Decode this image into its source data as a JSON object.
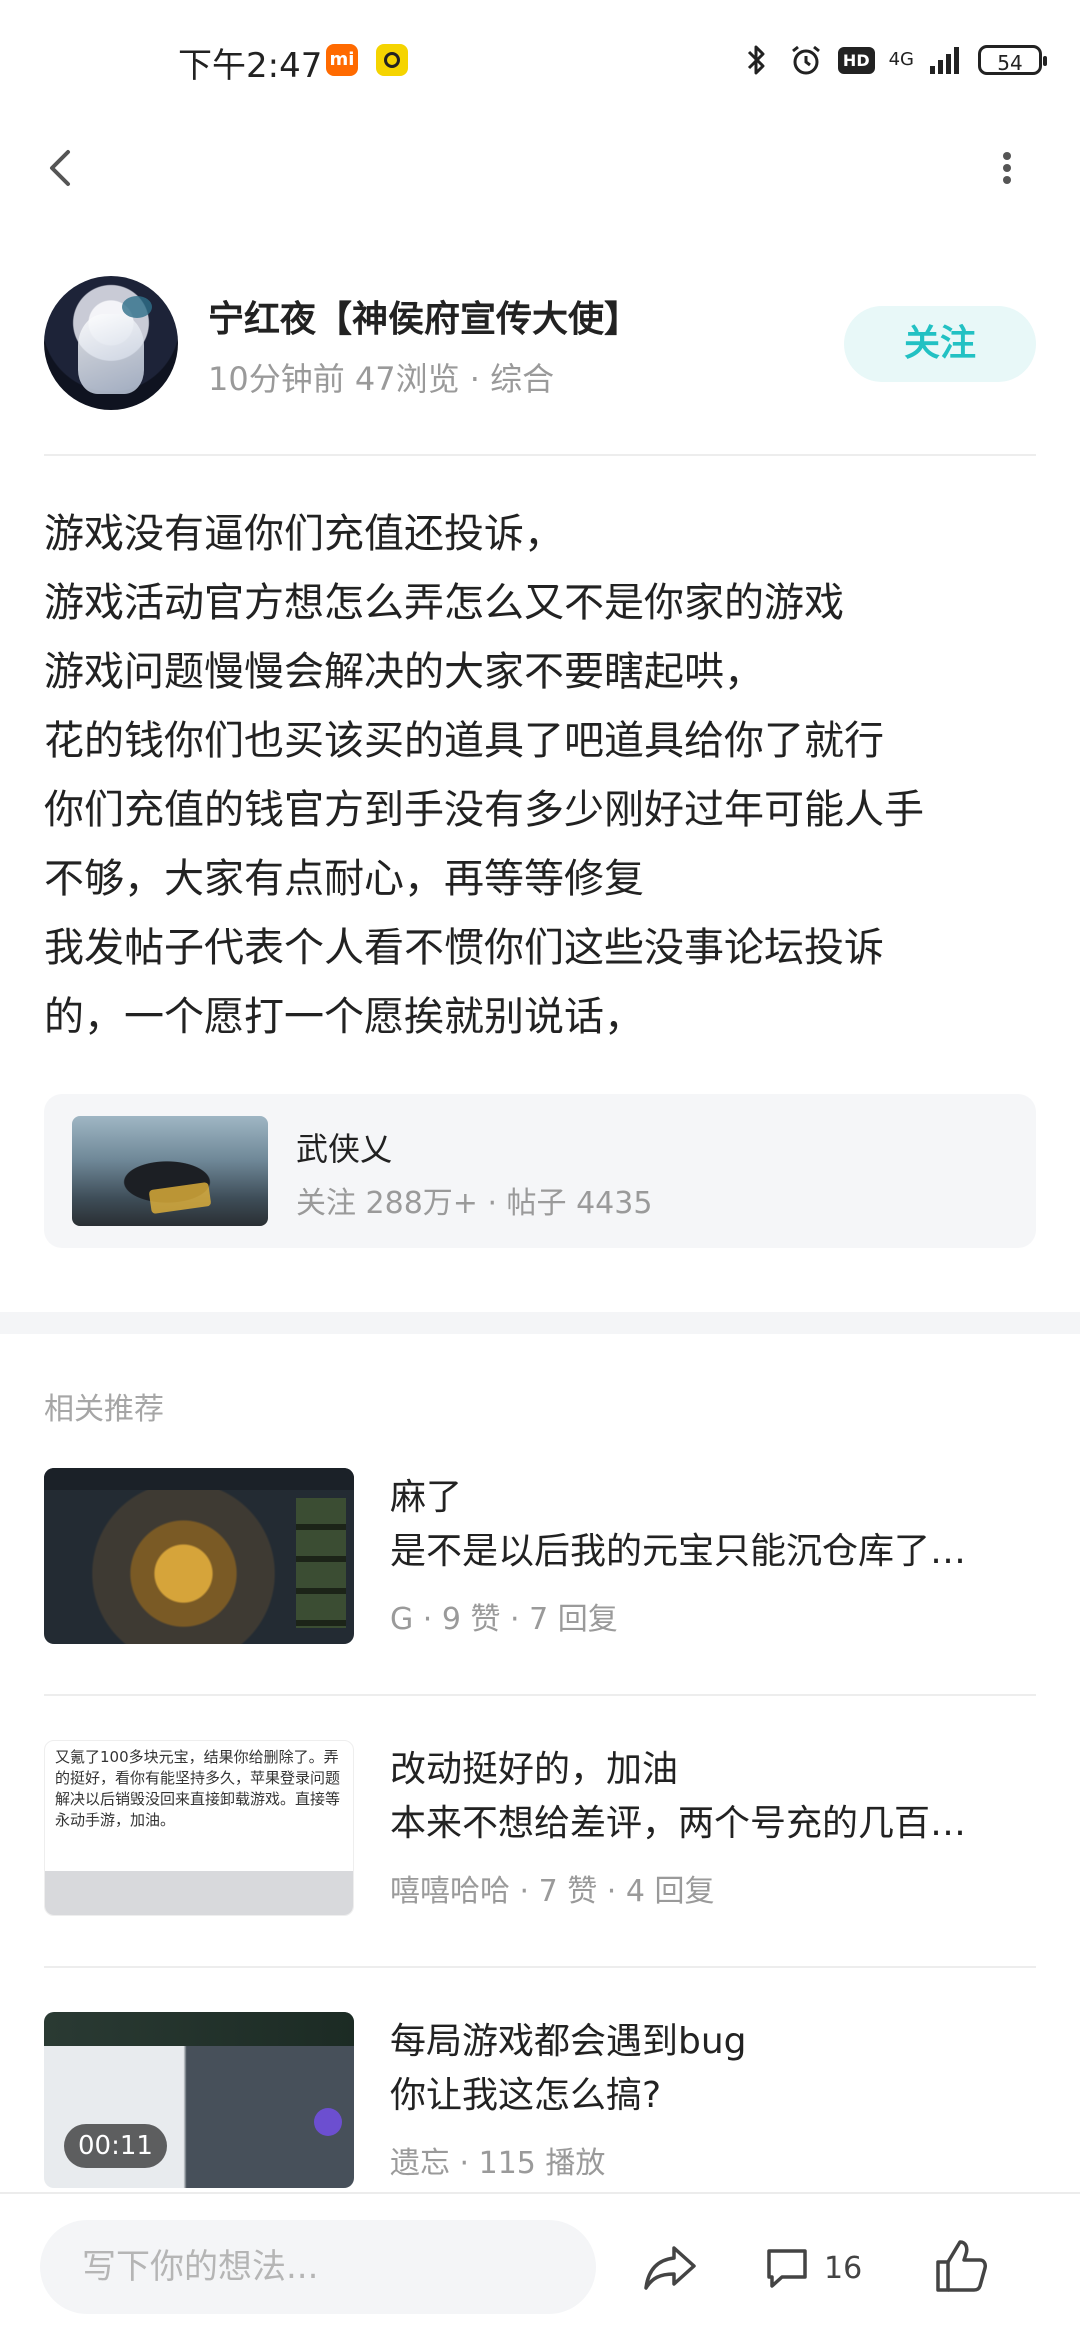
{
  "status_bar": {
    "time": "下午2:47",
    "app_badge": "mi",
    "network": "4G",
    "hd": "HD",
    "battery": "54"
  },
  "author": {
    "name": "宁红夜【神侯府宣传大使】",
    "meta": "10分钟前  47浏览  ·  综合",
    "follow_label": "关注"
  },
  "post": {
    "lines": [
      "游戏没有逼你们充值还投诉，",
      "游戏活动官方想怎么弄怎么又不是你家的游戏",
      "游戏问题慢慢会解决的大家不要瞎起哄，",
      "花的钱你们也买该买的道具了吧道具给你了就行",
      "你们充值的钱官方到手没有多少刚好过年可能人手",
      "不够，大家有点耐心，再等等修复",
      "我发帖子代表个人看不惯你们这些没事论坛投诉",
      "的，一个愿打一个愿挨就别说话，"
    ]
  },
  "game_card": {
    "name": "武侠乂",
    "stats": "关注 288万+  ·  帖子 4435"
  },
  "related": {
    "title": "相关推荐",
    "items": [
      {
        "line1": "麻了",
        "line2": "是不是以后我的元宝只能沉仓库了…",
        "meta": "G  ·  9 赞  ·  7 回复"
      },
      {
        "line1": "改动挺好的，加油",
        "line2": "本来不想给差评，两个号充的几百…",
        "meta": "嘻嘻哈哈  ·  7 赞  ·  4 回复",
        "thumb_text": "又氪了100多块元宝，结果你给删除了。弄的挺好，看你有能坚持多久，苹果登录问题解决以后销毁没回来直接卸载游戏。直接等永动手游，加油。"
      },
      {
        "line1": "每局游戏都会遇到bug",
        "line2": "你让我这怎么搞?",
        "meta": "遗忘  ·  115 播放",
        "duration": "00:11"
      }
    ]
  },
  "bottom_bar": {
    "input_placeholder": "写下你的想法...",
    "comment_count": "16"
  },
  "colors": {
    "accent": "#22c1c3",
    "follow_bg": "#e8f8f8",
    "muted_text": "#9a9a9a"
  }
}
